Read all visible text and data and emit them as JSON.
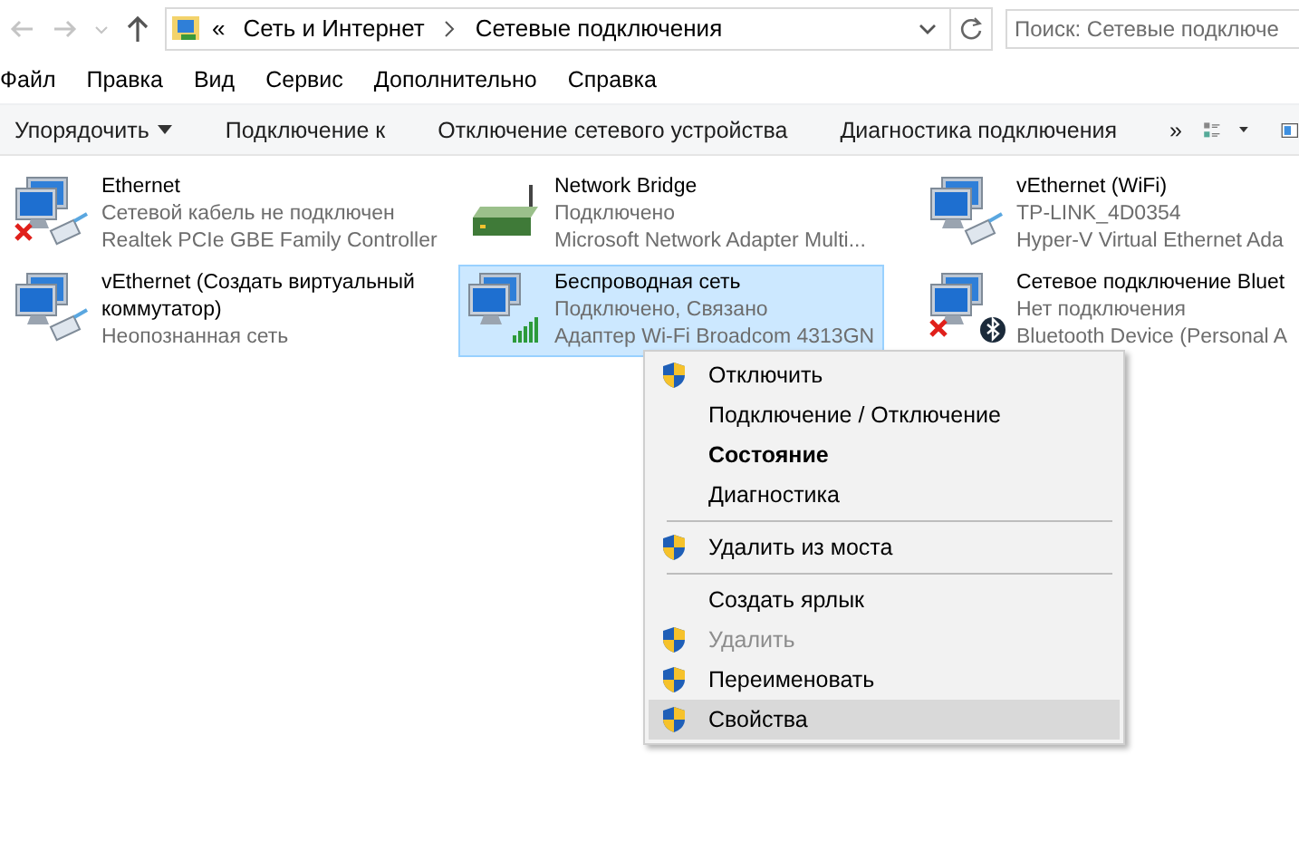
{
  "address": {
    "overflow": "«",
    "crumbs": [
      "Сеть и Интернет",
      "Сетевые подключения"
    ]
  },
  "search": {
    "placeholder": "Поиск: Сетевые подключе"
  },
  "menu": [
    "Файл",
    "Правка",
    "Вид",
    "Сервис",
    "Дополнительно",
    "Справка"
  ],
  "toolbar": [
    {
      "label": "Упорядочить",
      "dropdown": true
    },
    {
      "label": "Подключение к",
      "dropdown": false
    },
    {
      "label": "Отключение сетевого устройства",
      "dropdown": false
    },
    {
      "label": "Диагностика подключения",
      "dropdown": false
    }
  ],
  "toolbar_more": "»",
  "connections": [
    {
      "name": "Ethernet",
      "status": "Сетевой кабель не подключен",
      "device": "Realtek PCIe GBE Family Controller",
      "kind": "cable",
      "error": true,
      "selected": false
    },
    {
      "name": "Network Bridge",
      "status": "Подключено",
      "device": "Microsoft Network Adapter Multi...",
      "kind": "router",
      "error": false,
      "selected": false
    },
    {
      "name": "vEthernet (WiFi)",
      "status": "TP-LINK_4D0354",
      "device": "Hyper-V Virtual Ethernet Ada",
      "kind": "cable",
      "error": false,
      "selected": false
    },
    {
      "name": "vEthernet (Создать виртуальный коммутатор)",
      "status": "Неопознанная сеть",
      "kind": "cable",
      "error": false,
      "selected": false
    },
    {
      "name": "Беспроводная сеть",
      "status": "Подключено, Связано",
      "device": "Адаптер Wi-Fi Broadcom 4313GN",
      "kind": "wifi",
      "error": false,
      "selected": true
    },
    {
      "name": "Сетевое подключение Bluet",
      "status": "Нет подключения",
      "device": "Bluetooth Device (Personal A",
      "kind": "bluetooth",
      "error": true,
      "selected": false
    }
  ],
  "context_menu": [
    {
      "kind": "item",
      "label": "Отключить",
      "shield": true,
      "bold": false,
      "disabled": false,
      "selected": false
    },
    {
      "kind": "item",
      "label": "Подключение / Отключение",
      "shield": false,
      "bold": false,
      "disabled": false,
      "selected": false
    },
    {
      "kind": "item",
      "label": "Состояние",
      "shield": false,
      "bold": true,
      "disabled": false,
      "selected": false
    },
    {
      "kind": "item",
      "label": "Диагностика",
      "shield": false,
      "bold": false,
      "disabled": false,
      "selected": false
    },
    {
      "kind": "separator"
    },
    {
      "kind": "item",
      "label": "Удалить из моста",
      "shield": true,
      "bold": false,
      "disabled": false,
      "selected": false
    },
    {
      "kind": "separator"
    },
    {
      "kind": "item",
      "label": "Создать ярлык",
      "shield": false,
      "bold": false,
      "disabled": false,
      "selected": false
    },
    {
      "kind": "item",
      "label": "Удалить",
      "shield": true,
      "bold": false,
      "disabled": true,
      "selected": false
    },
    {
      "kind": "item",
      "label": "Переименовать",
      "shield": true,
      "bold": false,
      "disabled": false,
      "selected": false
    },
    {
      "kind": "item",
      "label": "Свойства",
      "shield": true,
      "bold": false,
      "disabled": false,
      "selected": true
    }
  ]
}
